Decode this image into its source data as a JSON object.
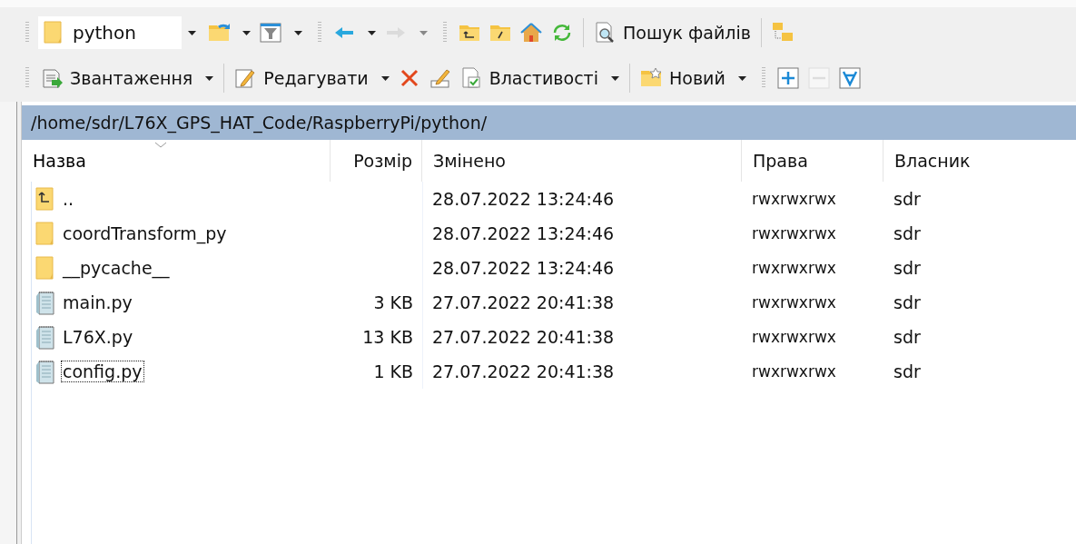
{
  "toolbars": [
    {
      "items": [
        {
          "kind": "grip"
        },
        {
          "kind": "combo",
          "value": "python"
        },
        {
          "kind": "tool",
          "has_menu": true,
          "disabled": false
        },
        {
          "kind": "tool",
          "has_menu": true,
          "disabled": false
        },
        {
          "kind": "grip"
        },
        {
          "kind": "tool",
          "has_menu": true,
          "disabled": false
        },
        {
          "kind": "tool",
          "has_menu": true,
          "disabled": true
        },
        {
          "kind": "grip"
        },
        {
          "kind": "tool",
          "has_menu": false,
          "disabled": false
        },
        {
          "kind": "tool",
          "has_menu": false,
          "disabled": false
        },
        {
          "kind": "tool",
          "has_menu": false,
          "disabled": false
        },
        {
          "kind": "tool",
          "has_menu": false,
          "disabled": false
        },
        {
          "kind": "separator"
        },
        {
          "kind": "tool",
          "label": "Пошук файлів",
          "has_menu": false,
          "disabled": false
        },
        {
          "kind": "separator"
        },
        {
          "kind": "tool",
          "has_menu": false,
          "disabled": false
        }
      ]
    },
    {
      "items": [
        {
          "kind": "grip"
        },
        {
          "kind": "tool",
          "label": "Звантаження",
          "has_menu": true,
          "disabled": false
        },
        {
          "kind": "separator"
        },
        {
          "kind": "tool",
          "label": "Редагувати",
          "has_menu": true,
          "disabled": false
        },
        {
          "kind": "tool",
          "has_menu": false,
          "disabled": false
        },
        {
          "kind": "tool",
          "has_menu": false,
          "disabled": false
        },
        {
          "kind": "tool",
          "label": "Властивості",
          "has_menu": true,
          "disabled": false
        },
        {
          "kind": "separator"
        },
        {
          "kind": "tool",
          "label": "Новий",
          "has_menu": true,
          "disabled": false
        },
        {
          "kind": "grip"
        },
        {
          "kind": "tool",
          "has_menu": false,
          "disabled": false
        },
        {
          "kind": "tool",
          "has_menu": false,
          "disabled": true
        },
        {
          "kind": "tool",
          "has_menu": false,
          "disabled": false
        }
      ]
    }
  ],
  "path_bar": {
    "path": "/home/sdr/L76X_GPS_HAT_Code/RaspberryPi/python/"
  },
  "table": {
    "columns": [
      {
        "label": "Назва",
        "sorted": true
      },
      {
        "label": "Розмір",
        "sorted": false
      },
      {
        "label": "Змінено",
        "sorted": false
      },
      {
        "label": "Права",
        "sorted": false
      },
      {
        "label": "Власник",
        "sorted": false
      }
    ],
    "rows": [
      {
        "kind": "parent",
        "name": "..",
        "size": "",
        "modified": "28.07.2022 13:24:46",
        "rights": "rwxrwxrwx",
        "owner": "sdr",
        "focused": false
      },
      {
        "kind": "folder",
        "name": "coordTransform_py",
        "size": "",
        "modified": "28.07.2022 13:24:46",
        "rights": "rwxrwxrwx",
        "owner": "sdr",
        "focused": false
      },
      {
        "kind": "folder",
        "name": "__pycache__",
        "size": "",
        "modified": "28.07.2022 13:24:46",
        "rights": "rwxrwxrwx",
        "owner": "sdr",
        "focused": false
      },
      {
        "kind": "file",
        "name": "main.py",
        "size": "3 KB",
        "modified": "27.07.2022 20:41:38",
        "rights": "rwxrwxrwx",
        "owner": "sdr",
        "focused": false
      },
      {
        "kind": "file",
        "name": "L76X.py",
        "size": "13 KB",
        "modified": "27.07.2022 20:41:38",
        "rights": "rwxrwxrwx",
        "owner": "sdr",
        "focused": false
      },
      {
        "kind": "file",
        "name": "config.py",
        "size": "1 KB",
        "modified": "27.07.2022 20:41:38",
        "rights": "rwxrwxrwx",
        "owner": "sdr",
        "focused": true
      }
    ]
  }
}
